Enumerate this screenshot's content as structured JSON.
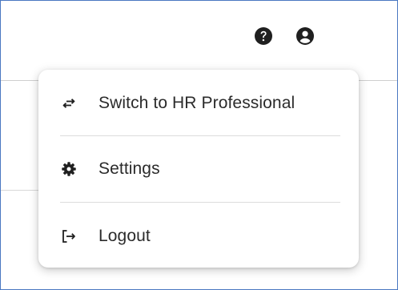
{
  "header": {
    "help_icon": "help-circle-icon",
    "account_icon": "account-circle-icon"
  },
  "menu": {
    "items": [
      {
        "label": "Switch to HR Professional",
        "icon": "swap-arrows-icon"
      },
      {
        "label": "Settings",
        "icon": "gear-icon"
      },
      {
        "label": "Logout",
        "icon": "logout-icon"
      }
    ]
  },
  "colors": {
    "frame_border": "#4a78c2",
    "text": "#2b2b2b",
    "icon": "#1f1f1f",
    "divider": "#dcdcdc"
  }
}
